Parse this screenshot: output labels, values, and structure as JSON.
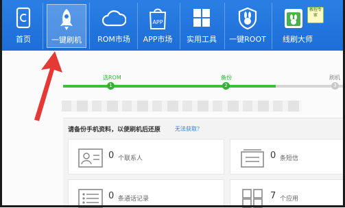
{
  "nav": {
    "items": [
      {
        "name": "home",
        "label": "首页"
      },
      {
        "name": "one-click-flash",
        "label": "一键刷机"
      },
      {
        "name": "rom-market",
        "label": "ROM市场"
      },
      {
        "name": "app-market",
        "label": "APP市场"
      },
      {
        "name": "tools",
        "label": "实用工具"
      },
      {
        "name": "one-click-root",
        "label": "一键ROOT"
      },
      {
        "name": "flash-master",
        "label": "线刷大师"
      }
    ],
    "app_icon_text": "APP",
    "badge": "教程专家"
  },
  "steps": [
    {
      "label": "选ROM",
      "number": "1"
    },
    {
      "label": "备份",
      "number": "2"
    },
    {
      "label": "刷机",
      "number": "3"
    }
  ],
  "panel": {
    "title": "请备份手机资料，以便刷机后还原",
    "link": "无法获取？"
  },
  "backup_items": [
    {
      "count": "0",
      "unit": "个联系人",
      "icon": "contact-card-icon"
    },
    {
      "count": "0",
      "unit": "条短信",
      "icon": "sms-icon"
    },
    {
      "count": "0",
      "unit": "条通话记录",
      "icon": "call-log-icon"
    },
    {
      "count": "7",
      "unit": "个应用",
      "icon": "apps-grid-icon"
    }
  ],
  "colors": {
    "topbar": "#2b7fe3",
    "progress_green": "#34b233",
    "annotation_arrow": "#e53935"
  }
}
